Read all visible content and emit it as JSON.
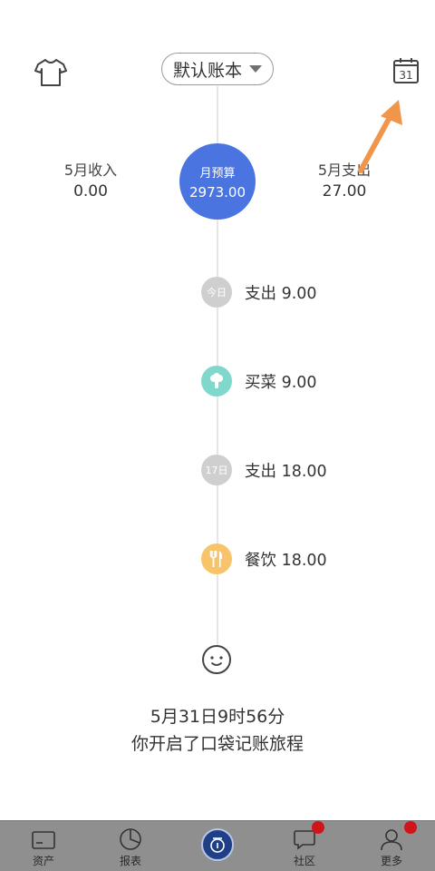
{
  "header": {
    "book_name": "默认账本",
    "icons": {
      "left": "shirt-icon",
      "right": "calendar-icon"
    },
    "calendar_day": "31"
  },
  "summary": {
    "income_label": "5月收入",
    "income_value": "0.00",
    "budget_label": "月预算",
    "budget_value": "2973.00",
    "expense_label": "5月支出",
    "expense_value": "27.00"
  },
  "timeline": [
    {
      "marker": "今日",
      "text": "支出 9.00",
      "style": "gray"
    },
    {
      "marker": "",
      "text": "买菜 9.00",
      "style": "teal",
      "icon": "broccoli-icon"
    },
    {
      "marker": "17日",
      "text": "支出 18.00",
      "style": "gray"
    },
    {
      "marker": "",
      "text": "餐饮 18.00",
      "style": "yellow",
      "icon": "fork-knife-icon"
    }
  ],
  "journey": {
    "date_line": "5月31日9时56分",
    "message": "你开启了口袋记账旅程"
  },
  "tabbar": {
    "items": [
      {
        "label": "资产",
        "icon": "card-icon"
      },
      {
        "label": "报表",
        "icon": "pie-chart-icon"
      },
      {
        "label": "",
        "icon": "add-record-icon"
      },
      {
        "label": "社区",
        "icon": "chat-icon"
      },
      {
        "label": "更多",
        "icon": "user-icon"
      }
    ]
  },
  "colors": {
    "accent": "#4a75e1",
    "arrow": "#f0954a",
    "tabbar": "#8f8f8f",
    "badge": "#d0141b"
  }
}
